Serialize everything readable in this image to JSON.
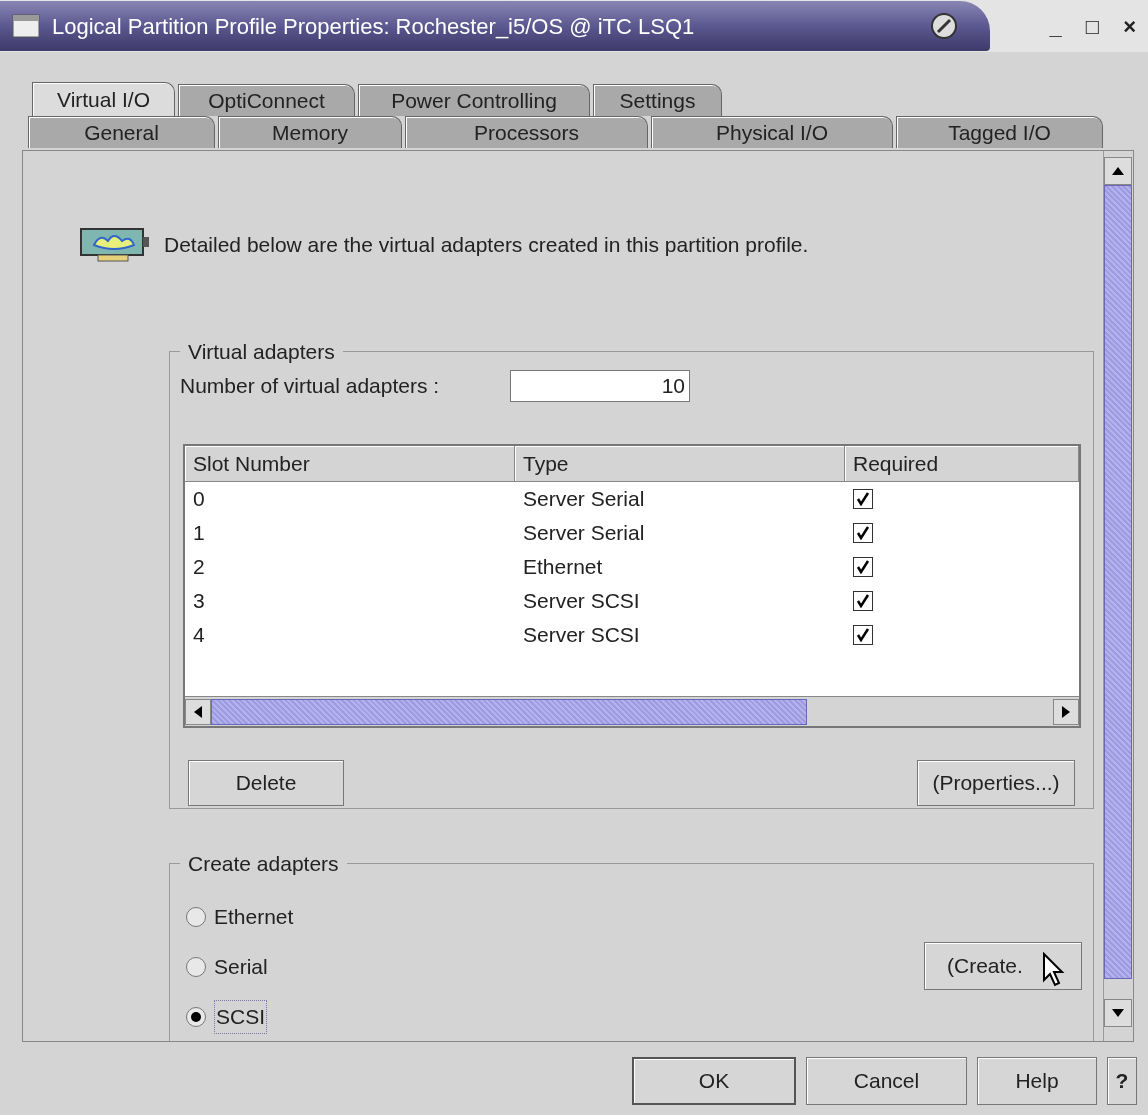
{
  "window": {
    "title": "Logical Partition Profile Properties: Rochester_i5/OS @ iTC LSQ1"
  },
  "title_controls": [
    "_",
    "□",
    "×"
  ],
  "tabs_row_1": [
    {
      "label": "Virtual I/O",
      "selected": true
    },
    {
      "label": "OptiConnect",
      "selected": false
    },
    {
      "label": "Power Controlling",
      "selected": false
    },
    {
      "label": "Settings",
      "selected": false
    }
  ],
  "tabs_row_2": [
    {
      "label": "General",
      "selected": false
    },
    {
      "label": "Memory",
      "selected": false
    },
    {
      "label": "Processors",
      "selected": false
    },
    {
      "label": "Physical I/O",
      "selected": false
    },
    {
      "label": "Tagged I/O",
      "selected": false
    }
  ],
  "intro": "Detailed below are the virtual adapters created in this partition profile.",
  "virtual_adapters": {
    "title": "Virtual adapters",
    "count_label": "Number of virtual adapters :",
    "count_value": "10",
    "table": {
      "columns": [
        "Slot Number",
        "Type",
        "Required"
      ],
      "rows": [
        {
          "slot": "0",
          "type": "Server Serial",
          "required": true
        },
        {
          "slot": "1",
          "type": "Server Serial",
          "required": true
        },
        {
          "slot": "2",
          "type": "Ethernet",
          "required": true
        },
        {
          "slot": "3",
          "type": "Server SCSI",
          "required": true
        },
        {
          "slot": "4",
          "type": "Server SCSI",
          "required": true
        }
      ]
    },
    "buttons": [
      "Delete",
      "(Properties...)"
    ]
  },
  "create_adapters": {
    "title": "Create adapters",
    "options": [
      {
        "label": "Ethernet",
        "selected": false
      },
      {
        "label": "Serial",
        "selected": false
      },
      {
        "label": "SCSI",
        "selected": true
      }
    ],
    "button": "(Create."
  },
  "footer_buttons": [
    "OK",
    "Cancel",
    "Help",
    "?"
  ]
}
